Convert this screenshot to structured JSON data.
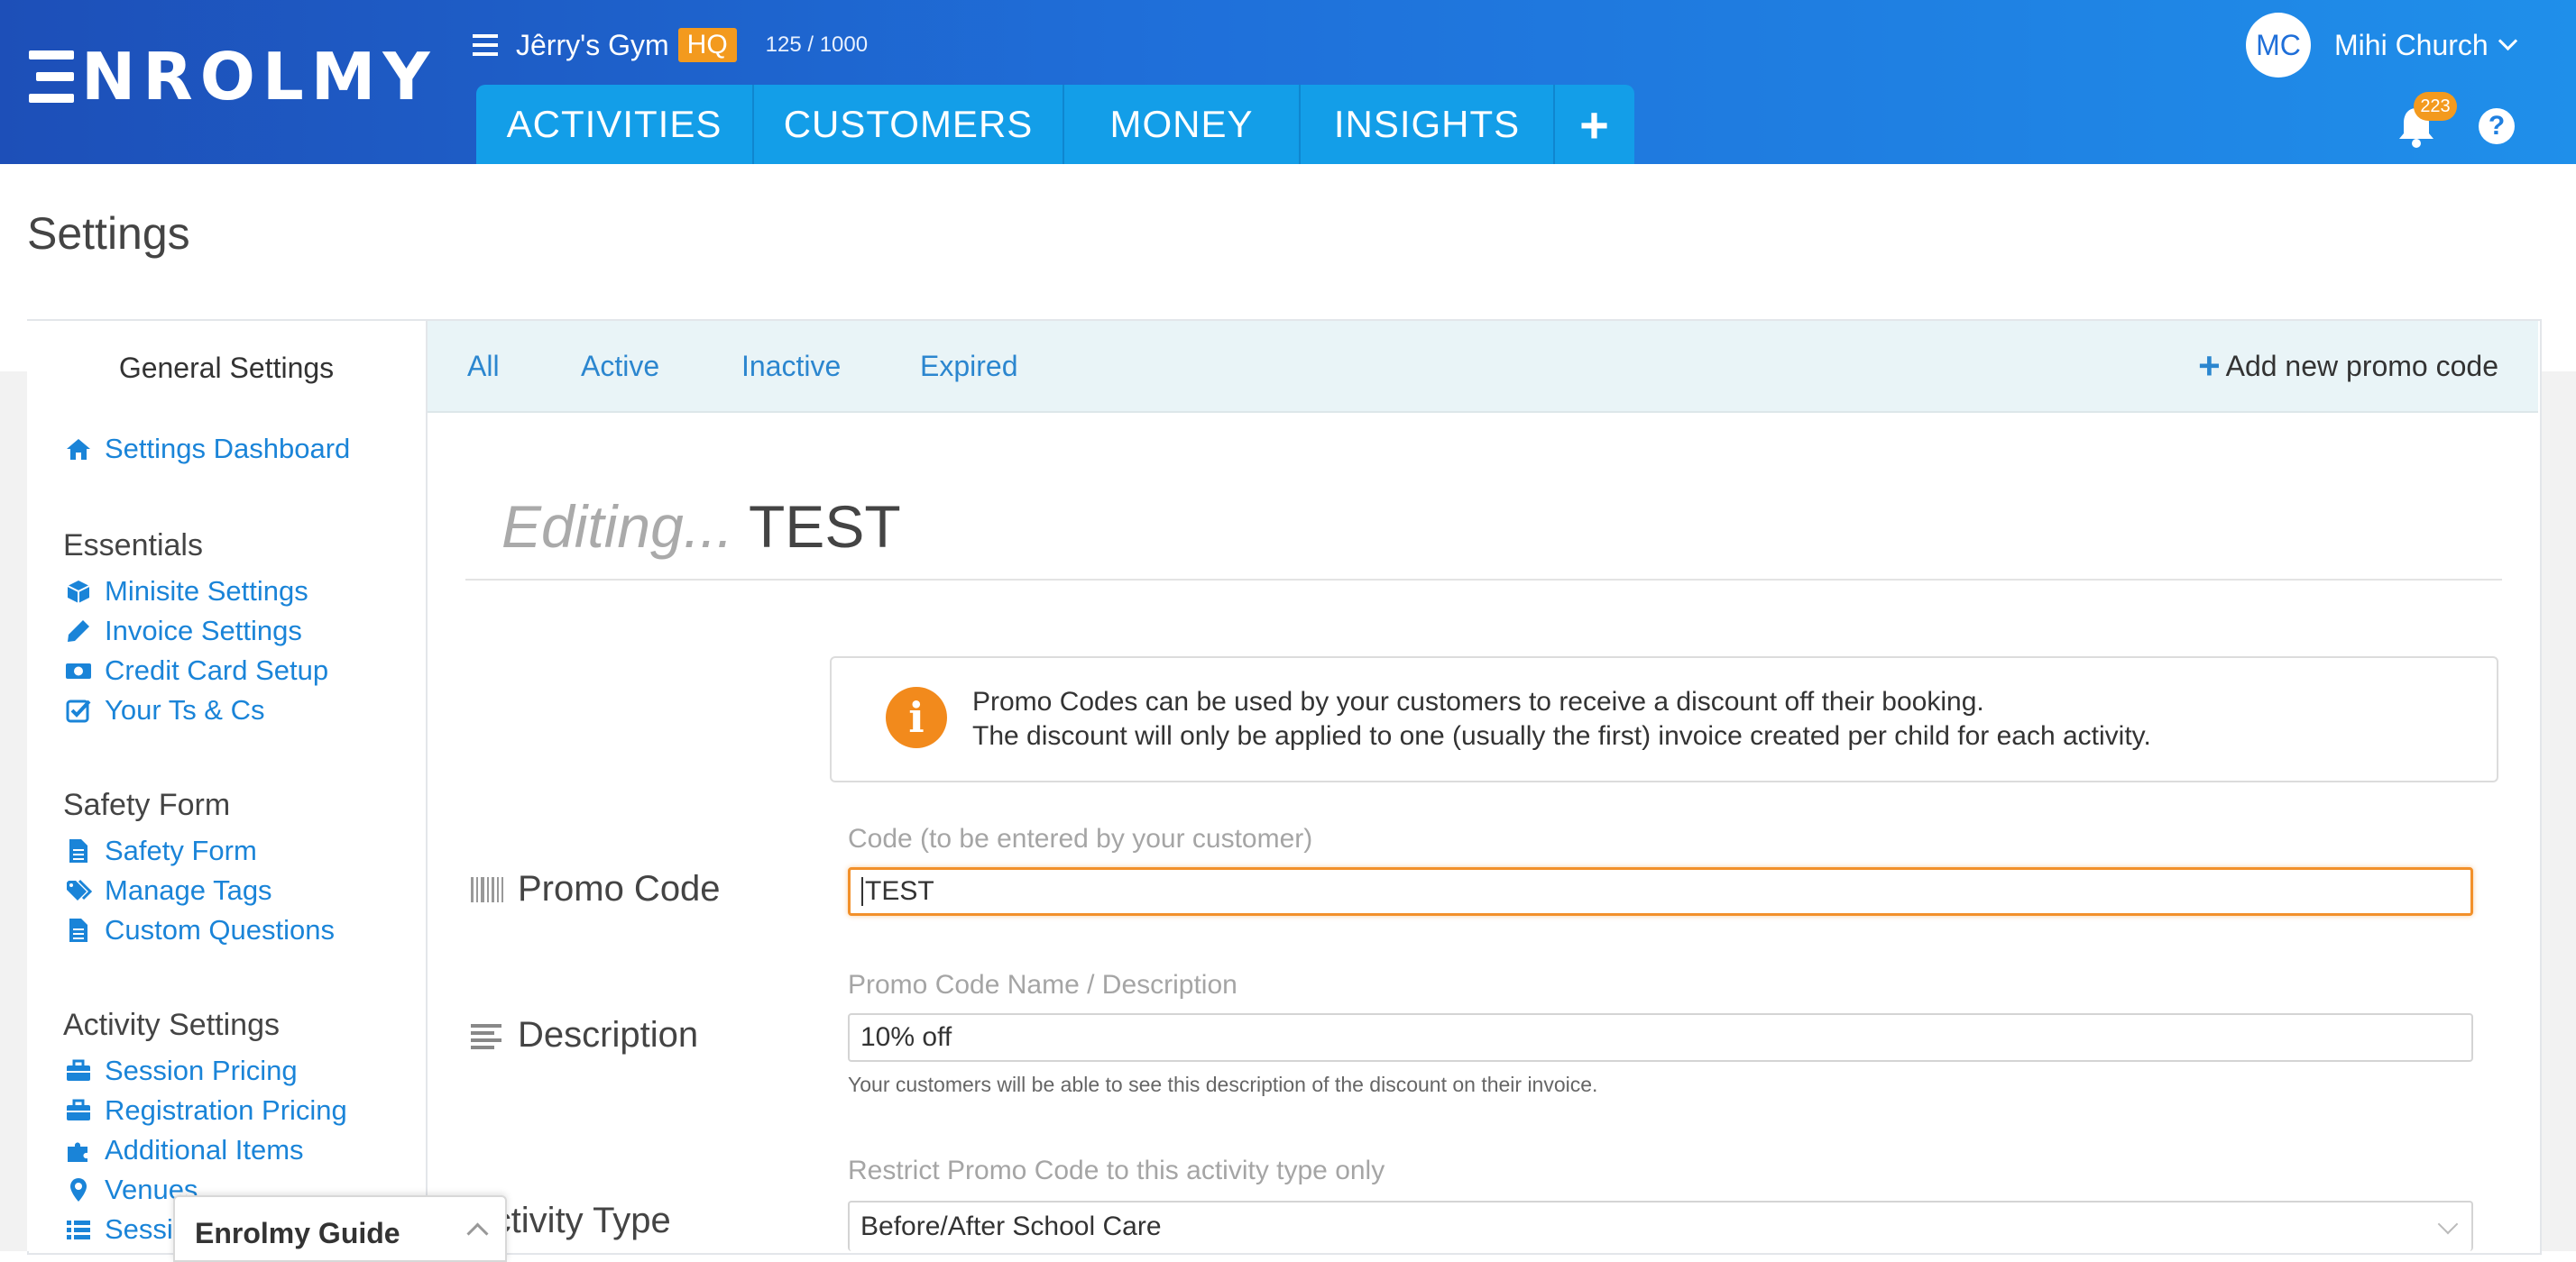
{
  "header": {
    "logo_rest": "NROLMY",
    "org_name": "Jêrry's Gym",
    "org_badge": "HQ",
    "org_count": "125 / 1000",
    "tabs": [
      {
        "label": "ACTIVITIES"
      },
      {
        "label": "CUSTOMERS"
      },
      {
        "label": "MONEY"
      },
      {
        "label": "INSIGHTS"
      },
      {
        "label": "+"
      }
    ],
    "user_initials": "MC",
    "user_name": "Mihi Church",
    "notification_count": "223",
    "help_label": "?",
    "brand_color": "#1f6fd9",
    "accent_color": "#f39a1e"
  },
  "page": {
    "title": "Settings"
  },
  "sidebar": {
    "heading": "General Settings",
    "dashboard_link": "Settings Dashboard",
    "groups": [
      {
        "title": "Essentials",
        "items": [
          {
            "label": "Minisite Settings",
            "icon": "cube-icon"
          },
          {
            "label": "Invoice Settings",
            "icon": "pencil-icon"
          },
          {
            "label": "Credit Card Setup",
            "icon": "money-icon"
          },
          {
            "label": "Your Ts & Cs",
            "icon": "check-square-icon"
          }
        ]
      },
      {
        "title": "Safety Form",
        "items": [
          {
            "label": "Safety Form",
            "icon": "file-icon"
          },
          {
            "label": "Manage Tags",
            "icon": "tags-icon"
          },
          {
            "label": "Custom Questions",
            "icon": "file-icon"
          }
        ]
      },
      {
        "title": "Activity Settings",
        "items": [
          {
            "label": "Session Pricing",
            "icon": "briefcase-icon"
          },
          {
            "label": "Registration Pricing",
            "icon": "briefcase-icon"
          },
          {
            "label": "Additional Items",
            "icon": "puzzle-icon"
          },
          {
            "label": "Venues",
            "icon": "map-marker-icon"
          },
          {
            "label": "Sessions",
            "icon": "list-icon"
          }
        ]
      }
    ]
  },
  "subtabs": {
    "items": [
      {
        "label": "All"
      },
      {
        "label": "Active"
      },
      {
        "label": "Inactive"
      },
      {
        "label": "Expired"
      }
    ],
    "add_new": "Add new promo code"
  },
  "editor": {
    "editing_prefix": "Editing...",
    "code_title": "TEST",
    "info_line1": "Promo Codes can be used by your customers to receive a discount off their booking.",
    "info_line2": "The discount will only be applied to one (usually the first) invoice created per child for each activity.",
    "promo_code": {
      "label": "Promo Code",
      "caption": "Code (to be entered by your customer)",
      "value": "TEST"
    },
    "description": {
      "label": "Description",
      "caption": "Promo Code Name / Description",
      "value": "10% off",
      "help": "Your customers will be able to see this description of the discount on their invoice."
    },
    "activity_type": {
      "label": "Activity Type",
      "caption": "Restrict Promo Code to this activity type only",
      "value": "Before/After School Care"
    }
  },
  "guide": {
    "title": "Enrolmy Guide"
  }
}
